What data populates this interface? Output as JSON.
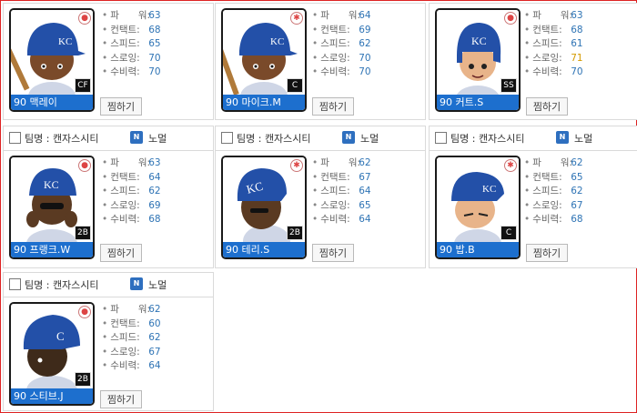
{
  "team_label": "팀명 : 캔자스시티",
  "grade_badge": "N",
  "grade_label": "노멀",
  "zzim_label": "찜하기",
  "stat_labels": [
    "파　　워:",
    "컨택트:",
    "스피드:",
    "스로잉:",
    "수비력:"
  ],
  "cards": [
    {
      "name": "90 맥레이",
      "position": "CF",
      "stats": [
        63,
        68,
        65,
        70,
        70
      ],
      "has_header": false
    },
    {
      "name": "90 마이크.M",
      "position": "C",
      "stats": [
        64,
        69,
        62,
        70,
        70
      ],
      "has_header": false
    },
    {
      "name": "90 커트.S",
      "position": "SS",
      "stats": [
        63,
        68,
        61,
        71,
        70
      ],
      "has_header": false
    },
    {
      "name": "90 프랭크.W",
      "position": "2B",
      "stats": [
        63,
        64,
        62,
        69,
        68
      ],
      "has_header": true
    },
    {
      "name": "90 테리.S",
      "position": "2B",
      "stats": [
        62,
        67,
        64,
        65,
        64
      ],
      "has_header": true
    },
    {
      "name": "90 밥.B",
      "position": "C",
      "stats": [
        62,
        65,
        62,
        67,
        68
      ],
      "has_header": true
    },
    {
      "name": "90 스티브.J",
      "position": "2B",
      "stats": [
        62,
        60,
        62,
        67,
        64
      ],
      "has_header": true
    }
  ],
  "colors": {
    "name_bar": "#1d6fce",
    "stat_value": "#2f74b5",
    "stat_highlight": "#d49a00",
    "helmet": "#2350a8"
  },
  "icons": {
    "corner": "bat-ball-icon",
    "grade": "n-grade-icon"
  }
}
